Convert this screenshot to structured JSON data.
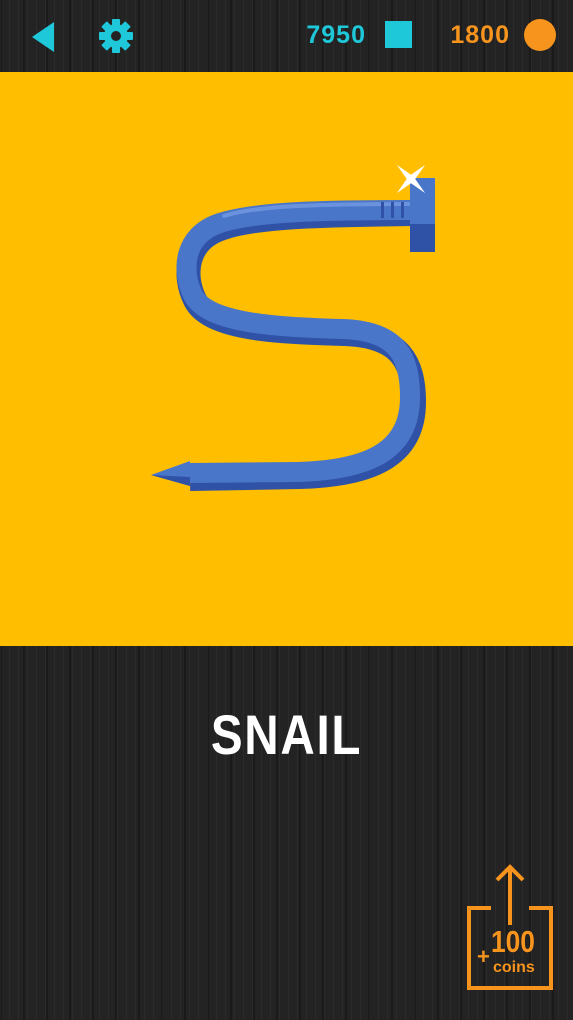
{
  "header": {
    "back_icon": "back-triangle-icon",
    "settings_icon": "gear-icon",
    "gems": "7950",
    "gem_icon": "square-gem-icon",
    "coins": "1800",
    "coin_icon": "coin-icon"
  },
  "item": {
    "name": "SNAIL",
    "illustration": "bent-nail-s-shape"
  },
  "share": {
    "icon": "share-arrow-icon",
    "plus": "+",
    "amount": "100",
    "unit": "coins"
  },
  "colors": {
    "cyan": "#1ec8d8",
    "orange": "#f7941d",
    "panel_yellow": "#ffbe00",
    "nail_blue": "#4a76c9",
    "nail_dark": "#2f52a6"
  }
}
